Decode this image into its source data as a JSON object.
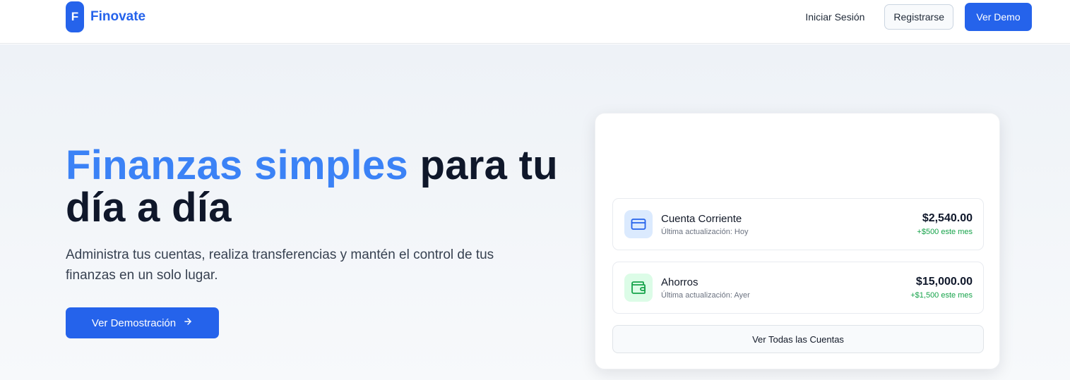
{
  "brand": {
    "logo_letter": "F",
    "name": "Finovate",
    "color": "#2563eb"
  },
  "nav": {
    "login": "Iniciar Sesión",
    "register": "Registrarse",
    "demo": "Ver Demo"
  },
  "hero": {
    "title_accent": "Finanzas simples",
    "title_rest": " para tu día a día",
    "subtitle": "Administra tus cuentas, realiza transferencias y mantén el control de tus finanzas en un solo lugar.",
    "cta": "Ver Demostración",
    "cta_icon": "arrow-right-icon"
  },
  "accounts": [
    {
      "name": "Cuenta Corriente",
      "updated": "Última actualización: Hoy",
      "balance": "$2,540.00",
      "change": "+$500 este mes",
      "icon": "credit-card-icon",
      "icon_color": "#2563eb",
      "icon_bg": "#dbeafe"
    },
    {
      "name": "Ahorros",
      "updated": "Última actualización: Ayer",
      "balance": "$15,000.00",
      "change": "+$1,500 este mes",
      "icon": "wallet-icon",
      "icon_color": "#16a34a",
      "icon_bg": "#dcfce7"
    }
  ],
  "view_all": "Ver Todas las Cuentas",
  "colors": {
    "primary": "#2563eb",
    "accent_text": "#3b82f6",
    "positive": "#16a34a"
  }
}
